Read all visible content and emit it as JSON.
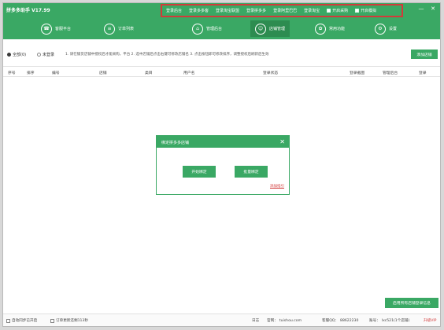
{
  "window": {
    "title": "拼多多助手 V17.99",
    "controls": {
      "minimize": "—",
      "close": "✕"
    }
  },
  "quicklinks": [
    {
      "label": "登录后台"
    },
    {
      "label": "登录多多客"
    },
    {
      "label": "登录淘宝联盟"
    },
    {
      "label": "登录拼多多"
    },
    {
      "label": "登录阿里巴巴"
    },
    {
      "label": "登录淘宝"
    },
    {
      "label": "开启采购",
      "checkbox": true
    },
    {
      "label": "开启模拟",
      "checkbox": true
    }
  ],
  "nav": [
    {
      "label": "客服平台",
      "icon": "headset-icon",
      "glyph": "☎"
    },
    {
      "label": "订单列表",
      "icon": "list-icon",
      "glyph": "≡"
    },
    {
      "label": "管理后台",
      "icon": "shopping-icon",
      "glyph": "⌂"
    },
    {
      "label": "店铺管理",
      "icon": "user-icon",
      "glyph": "☺",
      "active": true
    },
    {
      "label": "常用功能",
      "icon": "settings-icon",
      "glyph": "✿"
    },
    {
      "label": "设置",
      "icon": "gear-icon",
      "glyph": "⚙"
    }
  ],
  "toolbar": {
    "filter_all": "全部(0)",
    "filter_unlogged": "未登录",
    "hint": "1. 请在铺货店铺中授权后才能采购，平台  2. 选中店铺后点击右键可修改店铺名  3. 点击按钮即可修改排序，调整授权后刷新后生效",
    "add_button": "添加店铺"
  },
  "table": {
    "headers": [
      "序号",
      "排序",
      "编号",
      "店铺",
      "类目",
      "用户名",
      "登录状态",
      "登录截图",
      "管理后台",
      "登录"
    ]
  },
  "modal": {
    "title": "绑定拼多多店铺",
    "close": "✕",
    "start_button": "开始绑定",
    "batch_button": "批量绑定",
    "link": "添加指引"
  },
  "sync_button": "启用所有店铺登录信息",
  "statusbar": {
    "auto_check": "自动同步已开启",
    "order_check": "订单更新还剩113秒",
    "site_label": "官网：",
    "site": "tuishou.com",
    "qq_label": "客服QQ：",
    "qq": "88622230",
    "account_label": "账号：",
    "account": "lxc521(1个店铺)",
    "vip": "升级VIP",
    "extra": "日志"
  }
}
